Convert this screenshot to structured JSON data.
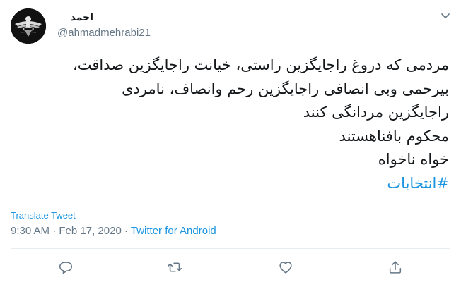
{
  "user": {
    "display_name": "احمد",
    "handle": "@ahmadmehrabi21",
    "avatar": "faravahar-emblem"
  },
  "tweet": {
    "lines": [
      "مردمی که دروغ راجایگزین راستی، خیانت راجایگزین صداقت،",
      "بیرحمی وبی انصافی راجایگزین رحم وانصاف، نامردی",
      "راجایگزین مردانگی کنند",
      "محکوم بافناهستند",
      "خواه ناخواه"
    ],
    "hashtag": "#انتخابات"
  },
  "translate_label": "Translate Tweet",
  "meta": {
    "time": "9:30 AM",
    "dot": " · ",
    "date": "Feb 17, 2020",
    "dot2": " · ",
    "source": "Twitter for Android"
  },
  "icons": {
    "more": "chevron-down-icon",
    "reply": "reply-icon",
    "retweet": "retweet-icon",
    "like": "heart-icon",
    "share": "share-icon"
  },
  "colors": {
    "link": "#1b95e0",
    "secondary": "#657786",
    "text": "#14171a"
  }
}
